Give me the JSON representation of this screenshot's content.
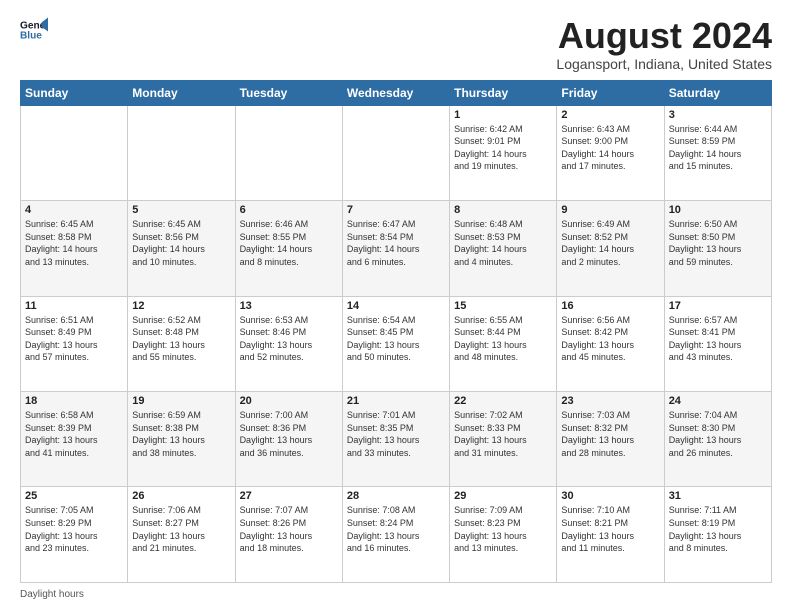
{
  "logo": {
    "line1": "General",
    "line2": "Blue"
  },
  "title": "August 2024",
  "subtitle": "Logansport, Indiana, United States",
  "days_header": [
    "Sunday",
    "Monday",
    "Tuesday",
    "Wednesday",
    "Thursday",
    "Friday",
    "Saturday"
  ],
  "footer_text": "Daylight hours",
  "weeks": [
    [
      {
        "num": "",
        "info": ""
      },
      {
        "num": "",
        "info": ""
      },
      {
        "num": "",
        "info": ""
      },
      {
        "num": "",
        "info": ""
      },
      {
        "num": "1",
        "info": "Sunrise: 6:42 AM\nSunset: 9:01 PM\nDaylight: 14 hours\nand 19 minutes."
      },
      {
        "num": "2",
        "info": "Sunrise: 6:43 AM\nSunset: 9:00 PM\nDaylight: 14 hours\nand 17 minutes."
      },
      {
        "num": "3",
        "info": "Sunrise: 6:44 AM\nSunset: 8:59 PM\nDaylight: 14 hours\nand 15 minutes."
      }
    ],
    [
      {
        "num": "4",
        "info": "Sunrise: 6:45 AM\nSunset: 8:58 PM\nDaylight: 14 hours\nand 13 minutes."
      },
      {
        "num": "5",
        "info": "Sunrise: 6:45 AM\nSunset: 8:56 PM\nDaylight: 14 hours\nand 10 minutes."
      },
      {
        "num": "6",
        "info": "Sunrise: 6:46 AM\nSunset: 8:55 PM\nDaylight: 14 hours\nand 8 minutes."
      },
      {
        "num": "7",
        "info": "Sunrise: 6:47 AM\nSunset: 8:54 PM\nDaylight: 14 hours\nand 6 minutes."
      },
      {
        "num": "8",
        "info": "Sunrise: 6:48 AM\nSunset: 8:53 PM\nDaylight: 14 hours\nand 4 minutes."
      },
      {
        "num": "9",
        "info": "Sunrise: 6:49 AM\nSunset: 8:52 PM\nDaylight: 14 hours\nand 2 minutes."
      },
      {
        "num": "10",
        "info": "Sunrise: 6:50 AM\nSunset: 8:50 PM\nDaylight: 13 hours\nand 59 minutes."
      }
    ],
    [
      {
        "num": "11",
        "info": "Sunrise: 6:51 AM\nSunset: 8:49 PM\nDaylight: 13 hours\nand 57 minutes."
      },
      {
        "num": "12",
        "info": "Sunrise: 6:52 AM\nSunset: 8:48 PM\nDaylight: 13 hours\nand 55 minutes."
      },
      {
        "num": "13",
        "info": "Sunrise: 6:53 AM\nSunset: 8:46 PM\nDaylight: 13 hours\nand 52 minutes."
      },
      {
        "num": "14",
        "info": "Sunrise: 6:54 AM\nSunset: 8:45 PM\nDaylight: 13 hours\nand 50 minutes."
      },
      {
        "num": "15",
        "info": "Sunrise: 6:55 AM\nSunset: 8:44 PM\nDaylight: 13 hours\nand 48 minutes."
      },
      {
        "num": "16",
        "info": "Sunrise: 6:56 AM\nSunset: 8:42 PM\nDaylight: 13 hours\nand 45 minutes."
      },
      {
        "num": "17",
        "info": "Sunrise: 6:57 AM\nSunset: 8:41 PM\nDaylight: 13 hours\nand 43 minutes."
      }
    ],
    [
      {
        "num": "18",
        "info": "Sunrise: 6:58 AM\nSunset: 8:39 PM\nDaylight: 13 hours\nand 41 minutes."
      },
      {
        "num": "19",
        "info": "Sunrise: 6:59 AM\nSunset: 8:38 PM\nDaylight: 13 hours\nand 38 minutes."
      },
      {
        "num": "20",
        "info": "Sunrise: 7:00 AM\nSunset: 8:36 PM\nDaylight: 13 hours\nand 36 minutes."
      },
      {
        "num": "21",
        "info": "Sunrise: 7:01 AM\nSunset: 8:35 PM\nDaylight: 13 hours\nand 33 minutes."
      },
      {
        "num": "22",
        "info": "Sunrise: 7:02 AM\nSunset: 8:33 PM\nDaylight: 13 hours\nand 31 minutes."
      },
      {
        "num": "23",
        "info": "Sunrise: 7:03 AM\nSunset: 8:32 PM\nDaylight: 13 hours\nand 28 minutes."
      },
      {
        "num": "24",
        "info": "Sunrise: 7:04 AM\nSunset: 8:30 PM\nDaylight: 13 hours\nand 26 minutes."
      }
    ],
    [
      {
        "num": "25",
        "info": "Sunrise: 7:05 AM\nSunset: 8:29 PM\nDaylight: 13 hours\nand 23 minutes."
      },
      {
        "num": "26",
        "info": "Sunrise: 7:06 AM\nSunset: 8:27 PM\nDaylight: 13 hours\nand 21 minutes."
      },
      {
        "num": "27",
        "info": "Sunrise: 7:07 AM\nSunset: 8:26 PM\nDaylight: 13 hours\nand 18 minutes."
      },
      {
        "num": "28",
        "info": "Sunrise: 7:08 AM\nSunset: 8:24 PM\nDaylight: 13 hours\nand 16 minutes."
      },
      {
        "num": "29",
        "info": "Sunrise: 7:09 AM\nSunset: 8:23 PM\nDaylight: 13 hours\nand 13 minutes."
      },
      {
        "num": "30",
        "info": "Sunrise: 7:10 AM\nSunset: 8:21 PM\nDaylight: 13 hours\nand 11 minutes."
      },
      {
        "num": "31",
        "info": "Sunrise: 7:11 AM\nSunset: 8:19 PM\nDaylight: 13 hours\nand 8 minutes."
      }
    ]
  ]
}
